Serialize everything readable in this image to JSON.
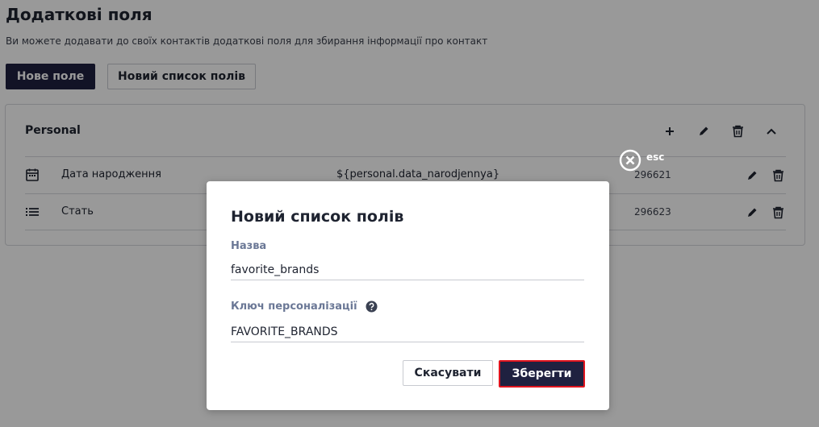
{
  "page": {
    "title": "Додаткові поля",
    "description": "Ви можете додавати до своїх контактів додаткові поля для збирання інформації про контакт",
    "new_field_label": "Нове поле",
    "new_list_label": "Новий список полів"
  },
  "group": {
    "title": "Personal",
    "actions": [
      "plus-icon",
      "pencil-icon",
      "trash-icon",
      "chevron-up-icon"
    ],
    "rows": [
      {
        "icon": "calendar-icon",
        "name": "Дата народження",
        "key": "${personal.data_narodjennya}",
        "id": "296621"
      },
      {
        "icon": "list-icon",
        "name": "Стать",
        "key": "",
        "id": "296623"
      }
    ]
  },
  "close": {
    "label": "esc"
  },
  "modal": {
    "title": "Новий список полів",
    "name_label": "Назва",
    "name_value": "favorite_brands",
    "key_label": "Ключ персоналізації",
    "key_value": "FAVORITE_BRANDS",
    "cancel_label": "Скасувати",
    "save_label": "Зберегти"
  },
  "colors": {
    "primary": "#1f2140",
    "highlight": "#e0141e",
    "label": "#6b7896"
  }
}
